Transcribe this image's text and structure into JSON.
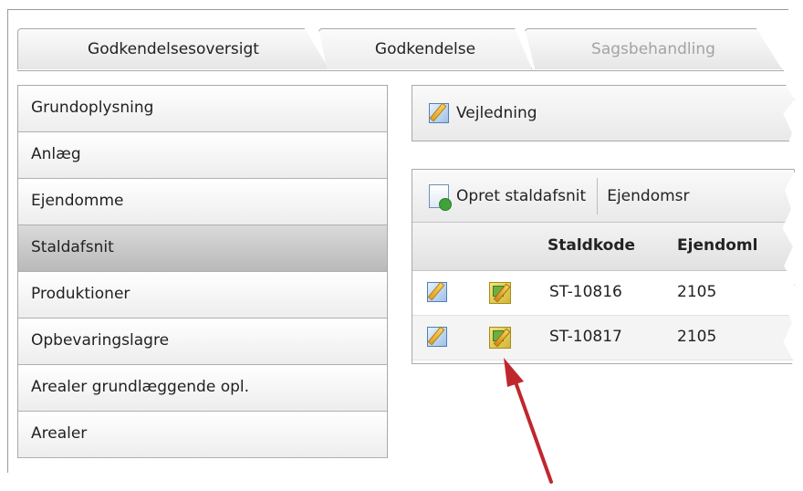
{
  "tabs": [
    {
      "label": "Godkendelsesoversigt",
      "state": "normal"
    },
    {
      "label": "Godkendelse",
      "state": "normal"
    },
    {
      "label": "Sagsbehandling",
      "state": "disabled"
    }
  ],
  "sidebar": {
    "items": [
      {
        "label": "Grundoplysning"
      },
      {
        "label": "Anlæg"
      },
      {
        "label": "Ejendomme"
      },
      {
        "label": "Staldafsnit",
        "active": true
      },
      {
        "label": "Produktioner"
      },
      {
        "label": "Opbevaringslagre"
      },
      {
        "label": "Arealer grundlæggende opl."
      },
      {
        "label": "Arealer"
      }
    ]
  },
  "guide_bar": {
    "label": "Vejledning",
    "icon": "edit-icon"
  },
  "grid": {
    "toolbar": {
      "create_label": "Opret staldafsnit",
      "create_icon": "new-document-icon",
      "second_label": "Ejendomsr"
    },
    "columns": [
      "Staldkode",
      "Ejendoml"
    ],
    "rows": [
      {
        "staldkode": "ST-10816",
        "ejendom": "2105"
      },
      {
        "staldkode": "ST-10817",
        "ejendom": "2105"
      }
    ]
  },
  "colors": {
    "active_item": "#c4c4c4",
    "arrow": "#c0272d",
    "disabled_text": "#a3a3a3"
  }
}
